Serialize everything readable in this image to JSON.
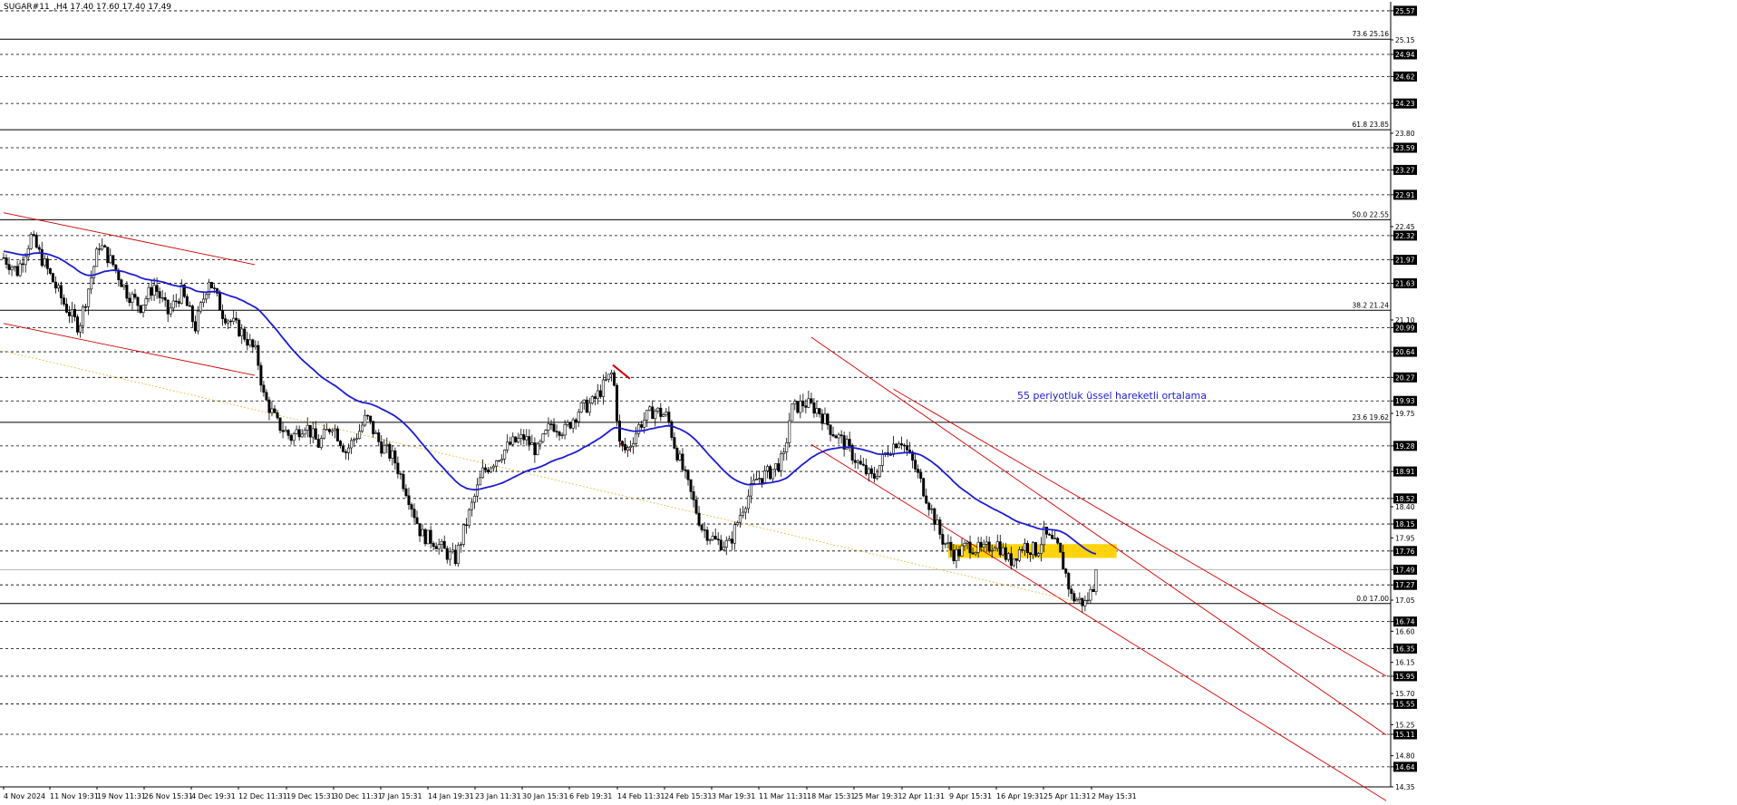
{
  "header": {
    "title": "SUGAR#11_,H4  17.40 17.60 17.40 17.49"
  },
  "colors": {
    "background": "#ffffff",
    "candle": "#000000",
    "ema": "#1c1cd0",
    "channel": "#cc0000",
    "fib_trend": "#e8c24a",
    "zone": "#ffd200",
    "annotation": "#1c1cd0",
    "grid": "#000000"
  },
  "chart_data": {
    "type": "candlestick",
    "symbol": "SUGAR#11_",
    "timeframe": "H4",
    "ylim": [
      14.35,
      25.7
    ],
    "current_price": 17.49,
    "x_tick_labels": [
      "4 Nov 2024",
      "11 Nov 19:31",
      "19 Nov 11:31",
      "26 Nov 15:31",
      "4 Dec 19:31",
      "12 Dec 11:31",
      "19 Dec 15:31",
      "30 Dec 11:31",
      "7 Jan 15:31",
      "14 Jan 19:31",
      "23 Jan 11:31",
      "30 Jan 15:31",
      "6 Feb 19:31",
      "14 Feb 11:31",
      "24 Feb 15:31",
      "3 Mar 19:31",
      "11 Mar 11:31",
      "18 Mar 15:31",
      "25 Mar 19:31",
      "2 Apr 11:31",
      "9 Apr 15:31",
      "16 Apr 19:31",
      "25 Apr 11:31",
      "2 May 15:31"
    ],
    "y_tick_labels": [
      25.57,
      25.15,
      24.94,
      24.62,
      24.23,
      23.8,
      23.59,
      23.27,
      22.91,
      22.45,
      22.32,
      21.97,
      21.63,
      21.1,
      20.99,
      20.64,
      20.27,
      19.93,
      19.75,
      19.28,
      18.91,
      18.52,
      18.4,
      18.15,
      17.95,
      17.76,
      17.49,
      17.27,
      17.05,
      16.74,
      16.6,
      16.35,
      16.15,
      15.95,
      15.7,
      15.55,
      15.25,
      15.11,
      14.8,
      14.64,
      14.35
    ],
    "boxed_levels": [
      25.57,
      24.94,
      24.62,
      24.23,
      23.59,
      23.27,
      22.91,
      22.32,
      21.97,
      21.63,
      20.99,
      20.64,
      20.27,
      19.93,
      19.28,
      18.91,
      18.52,
      18.15,
      17.76,
      17.49,
      17.27,
      16.74,
      16.35,
      15.95,
      15.55,
      15.11,
      14.64
    ],
    "dashed_levels": [
      25.57,
      24.94,
      24.62,
      24.23,
      23.59,
      23.27,
      22.91,
      22.32,
      21.97,
      21.63,
      20.99,
      20.64,
      20.27,
      19.93,
      19.28,
      18.91,
      18.52,
      18.15,
      17.76,
      17.27,
      16.74,
      16.35,
      15.95,
      15.55,
      15.11,
      14.64
    ],
    "fibonacci_levels": [
      {
        "label": "73.6 25.16",
        "value": 25.16
      },
      {
        "label": "61.8 23.85",
        "value": 23.85
      },
      {
        "label": "50.0 22.55",
        "value": 22.55
      },
      {
        "label": "38.2 21.24",
        "value": 21.24
      },
      {
        "label": "23.6 19.62",
        "value": 19.62
      },
      {
        "label": "0.0 17.00",
        "value": 17.0
      }
    ],
    "annotation": "55 periyotluk üssel hareketli ortalama",
    "zone": {
      "from": 17.66,
      "to": 17.86
    },
    "price_path": [
      {
        "t": 0,
        "p": 22.0
      },
      {
        "t": 2,
        "p": 21.8
      },
      {
        "t": 4,
        "p": 22.3
      },
      {
        "t": 6,
        "p": 21.9
      },
      {
        "t": 9,
        "p": 21.3
      },
      {
        "t": 11,
        "p": 21.0
      },
      {
        "t": 14,
        "p": 22.2
      },
      {
        "t": 16,
        "p": 21.9
      },
      {
        "t": 18,
        "p": 21.5
      },
      {
        "t": 20,
        "p": 21.3
      },
      {
        "t": 22,
        "p": 21.6
      },
      {
        "t": 24,
        "p": 21.2
      },
      {
        "t": 26,
        "p": 21.5
      },
      {
        "t": 28,
        "p": 21.0
      },
      {
        "t": 30,
        "p": 21.7
      },
      {
        "t": 32,
        "p": 21.2
      },
      {
        "t": 35,
        "p": 20.9
      },
      {
        "t": 37,
        "p": 20.6
      },
      {
        "t": 38,
        "p": 20.0
      },
      {
        "t": 40,
        "p": 19.6
      },
      {
        "t": 42,
        "p": 19.4
      },
      {
        "t": 44,
        "p": 19.6
      },
      {
        "t": 46,
        "p": 19.3
      },
      {
        "t": 48,
        "p": 19.6
      },
      {
        "t": 50,
        "p": 19.2
      },
      {
        "t": 52,
        "p": 19.5
      },
      {
        "t": 53,
        "p": 19.7
      },
      {
        "t": 55,
        "p": 19.3
      },
      {
        "t": 57,
        "p": 19.1
      },
      {
        "t": 59,
        "p": 18.6
      },
      {
        "t": 61,
        "p": 18.0
      },
      {
        "t": 63,
        "p": 17.9
      },
      {
        "t": 65,
        "p": 17.7
      },
      {
        "t": 66,
        "p": 17.65
      },
      {
        "t": 68,
        "p": 18.3
      },
      {
        "t": 70,
        "p": 18.9
      },
      {
        "t": 72,
        "p": 19.1
      },
      {
        "t": 74,
        "p": 19.3
      },
      {
        "t": 76,
        "p": 19.4
      },
      {
        "t": 78,
        "p": 19.2
      },
      {
        "t": 80,
        "p": 19.6
      },
      {
        "t": 82,
        "p": 19.5
      },
      {
        "t": 84,
        "p": 19.8
      },
      {
        "t": 86,
        "p": 19.9
      },
      {
        "t": 88,
        "p": 20.2
      },
      {
        "t": 89,
        "p": 20.35
      },
      {
        "t": 90,
        "p": 19.3
      },
      {
        "t": 91,
        "p": 19.2
      },
      {
        "t": 93,
        "p": 19.6
      },
      {
        "t": 95,
        "p": 19.8
      },
      {
        "t": 97,
        "p": 19.7
      },
      {
        "t": 98,
        "p": 19.3
      },
      {
        "t": 100,
        "p": 18.7
      },
      {
        "t": 102,
        "p": 18.1
      },
      {
        "t": 104,
        "p": 17.9
      },
      {
        "t": 106,
        "p": 17.85
      },
      {
        "t": 108,
        "p": 18.4
      },
      {
        "t": 110,
        "p": 18.8
      },
      {
        "t": 112,
        "p": 18.9
      },
      {
        "t": 114,
        "p": 19.1
      },
      {
        "t": 115,
        "p": 19.8
      },
      {
        "t": 117,
        "p": 19.9
      },
      {
        "t": 119,
        "p": 19.8
      },
      {
        "t": 121,
        "p": 19.5
      },
      {
        "t": 123,
        "p": 19.3
      },
      {
        "t": 125,
        "p": 19.0
      },
      {
        "t": 127,
        "p": 18.8
      },
      {
        "t": 129,
        "p": 19.2
      },
      {
        "t": 131,
        "p": 19.4
      },
      {
        "t": 133,
        "p": 19.0
      },
      {
        "t": 135,
        "p": 18.5
      },
      {
        "t": 137,
        "p": 17.95
      },
      {
        "t": 139,
        "p": 17.7
      },
      {
        "t": 141,
        "p": 17.85
      },
      {
        "t": 143,
        "p": 17.75
      },
      {
        "t": 145,
        "p": 17.9
      },
      {
        "t": 147,
        "p": 17.6
      },
      {
        "t": 149,
        "p": 17.85
      },
      {
        "t": 151,
        "p": 17.75
      },
      {
        "t": 152,
        "p": 18.0
      },
      {
        "t": 154,
        "p": 17.8
      },
      {
        "t": 155,
        "p": 17.5
      },
      {
        "t": 156,
        "p": 17.1
      },
      {
        "t": 158,
        "p": 17.0
      },
      {
        "t": 159,
        "p": 17.2
      },
      {
        "t": 160,
        "p": 17.49
      }
    ]
  }
}
